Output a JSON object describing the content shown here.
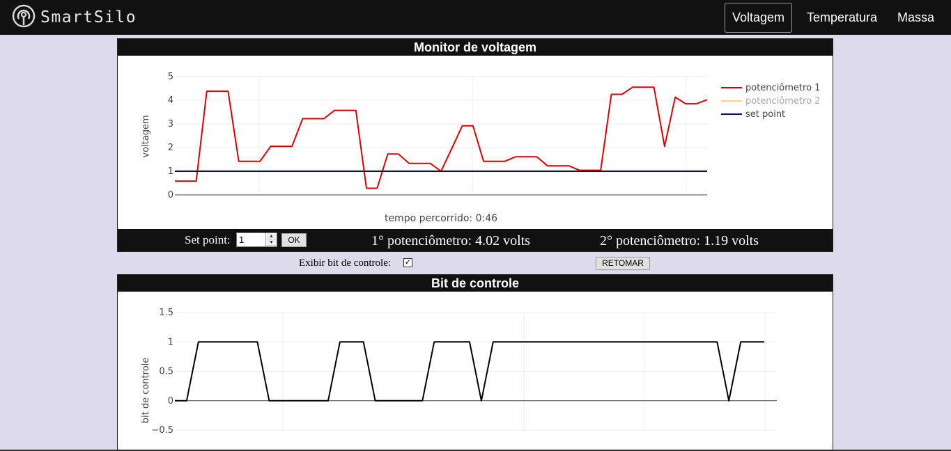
{
  "nav": {
    "brand": "SmartSilo",
    "items": [
      {
        "label": "Voltagem",
        "active": true
      },
      {
        "label": "Temperatura",
        "active": false
      },
      {
        "label": "Massa",
        "active": false
      }
    ]
  },
  "voltage_panel": {
    "title": "Monitor de voltagem",
    "elapsed": "tempo percorrido: 0:46",
    "setpoint_label": "Set point:",
    "setpoint_value": "1",
    "ok_label": "OK",
    "pot1_text": "1° potenciômetro: 4.02 volts",
    "pot2_text": "2° potenciômetro: 1.19 volts"
  },
  "controls": {
    "show_control_bit_label": "Exibir bit de controle:",
    "show_control_bit_checked": true,
    "resume_label": "RETOMAR"
  },
  "bit_panel": {
    "title": "Bit de controle"
  },
  "colors": {
    "pot1": "#d40000",
    "pot2": "#ffd86b",
    "setpoint": "#0a0a80",
    "bit": "#000000"
  },
  "chart_data": [
    {
      "type": "line",
      "ylabel": "voltagem",
      "ylim": [
        0,
        5
      ],
      "yticks": [
        0,
        1,
        2,
        3,
        4,
        5
      ],
      "legend_position": "top-right",
      "x": [
        0,
        1,
        2,
        3,
        4,
        5,
        6,
        7,
        8,
        9,
        10,
        11,
        12,
        13,
        14,
        15,
        16,
        17,
        18,
        19,
        20,
        21,
        22,
        23,
        24,
        25,
        26,
        27,
        28,
        29,
        30,
        31,
        32,
        33,
        34,
        35,
        36,
        37,
        38,
        39,
        40,
        41,
        42,
        43,
        44,
        45,
        46,
        47,
        48,
        49,
        50
      ],
      "series": [
        {
          "name": "potenciômetro 1",
          "values": [
            0.58,
            0.58,
            0.58,
            4.38,
            4.38,
            4.38,
            1.42,
            1.42,
            1.42,
            2.05,
            2.05,
            2.05,
            3.22,
            3.22,
            3.22,
            3.57,
            3.57,
            3.57,
            0.28,
            0.28,
            1.73,
            1.73,
            1.33,
            1.33,
            1.33,
            1.0,
            1.95,
            2.92,
            2.92,
            1.42,
            1.42,
            1.42,
            1.61,
            1.61,
            1.61,
            1.23,
            1.23,
            1.23,
            1.04,
            1.04,
            1.04,
            4.25,
            4.25,
            4.55,
            4.55,
            4.55,
            2.05,
            4.13,
            3.85,
            3.85,
            4.02
          ]
        },
        {
          "name": "potenciômetro 2",
          "values": [],
          "hidden": true
        },
        {
          "name": "set point",
          "values": [
            1,
            1,
            1,
            1,
            1,
            1,
            1,
            1,
            1,
            1,
            1,
            1,
            1,
            1,
            1,
            1,
            1,
            1,
            1,
            1,
            1,
            1,
            1,
            1,
            1,
            1,
            1,
            1,
            1,
            1,
            1,
            1,
            1,
            1,
            1,
            1,
            1,
            1,
            1,
            1,
            1,
            1,
            1,
            1,
            1,
            1,
            1,
            1,
            1,
            1,
            1
          ]
        }
      ]
    },
    {
      "type": "line",
      "ylabel": "bit de controle",
      "ylim": [
        -0.5,
        1.5
      ],
      "yticks": [
        -0.5,
        0,
        0.5,
        1,
        1.5
      ],
      "ytick_labels": [
        "−0.5",
        "0",
        "0.5",
        "1",
        "1.5"
      ],
      "x": [
        0,
        1,
        2,
        3,
        4,
        5,
        6,
        7,
        8,
        9,
        10,
        11,
        12,
        13,
        14,
        15,
        16,
        17,
        18,
        19,
        20,
        21,
        22,
        23,
        24,
        25,
        26,
        27,
        28,
        29,
        30,
        31,
        32,
        33,
        34,
        35,
        36,
        37,
        38,
        39,
        40,
        41,
        42,
        43,
        44,
        45,
        46,
        47,
        48,
        49,
        50
      ],
      "series": [
        {
          "name": "bit de controle",
          "values": [
            0,
            0,
            1,
            1,
            1,
            1,
            1,
            1,
            0,
            0,
            0,
            0,
            0,
            0,
            1,
            1,
            1,
            0,
            0,
            0,
            0,
            0,
            1,
            1,
            1,
            1,
            0,
            1,
            1,
            1,
            1,
            1,
            1,
            1,
            1,
            1,
            1,
            1,
            1,
            1,
            1,
            1,
            1,
            1,
            1,
            1,
            1,
            0,
            1,
            1,
            1
          ]
        }
      ]
    }
  ]
}
